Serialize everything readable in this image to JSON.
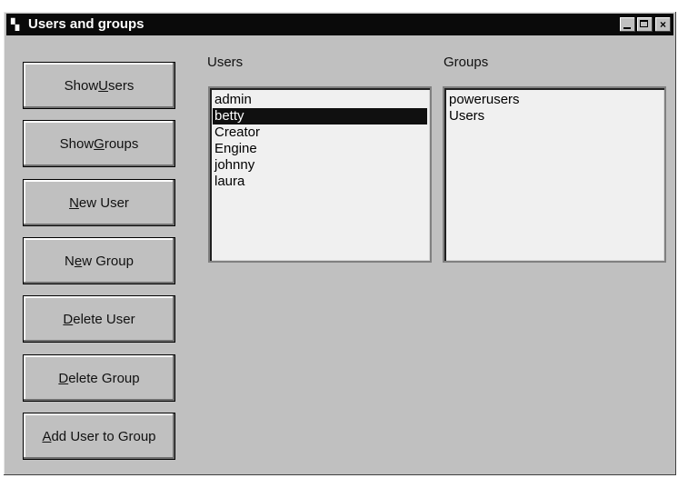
{
  "window": {
    "title": "Users and groups",
    "icon": "app-icon"
  },
  "title_buttons": {
    "minimize": "minimize-icon",
    "maximize": "maximize-icon",
    "close": "×"
  },
  "buttons": [
    {
      "pre": "Show ",
      "acc": "U",
      "post": "sers"
    },
    {
      "pre": "Show ",
      "acc": "G",
      "post": "roups"
    },
    {
      "pre": "",
      "acc": "N",
      "post": "ew User"
    },
    {
      "pre": "N",
      "acc": "e",
      "post": "w Group"
    },
    {
      "pre": "",
      "acc": "D",
      "post": "elete User"
    },
    {
      "pre": "",
      "acc": "D",
      "post": "elete Group"
    },
    {
      "pre": "",
      "acc": "A",
      "post": "dd User to Group"
    }
  ],
  "users": {
    "label": "Users",
    "items": [
      "admin",
      "betty",
      "Creator",
      "Engine",
      "johnny",
      "laura"
    ],
    "selected": "betty"
  },
  "groups": {
    "label": "Groups",
    "items": [
      "powerusers",
      "Users"
    ]
  }
}
